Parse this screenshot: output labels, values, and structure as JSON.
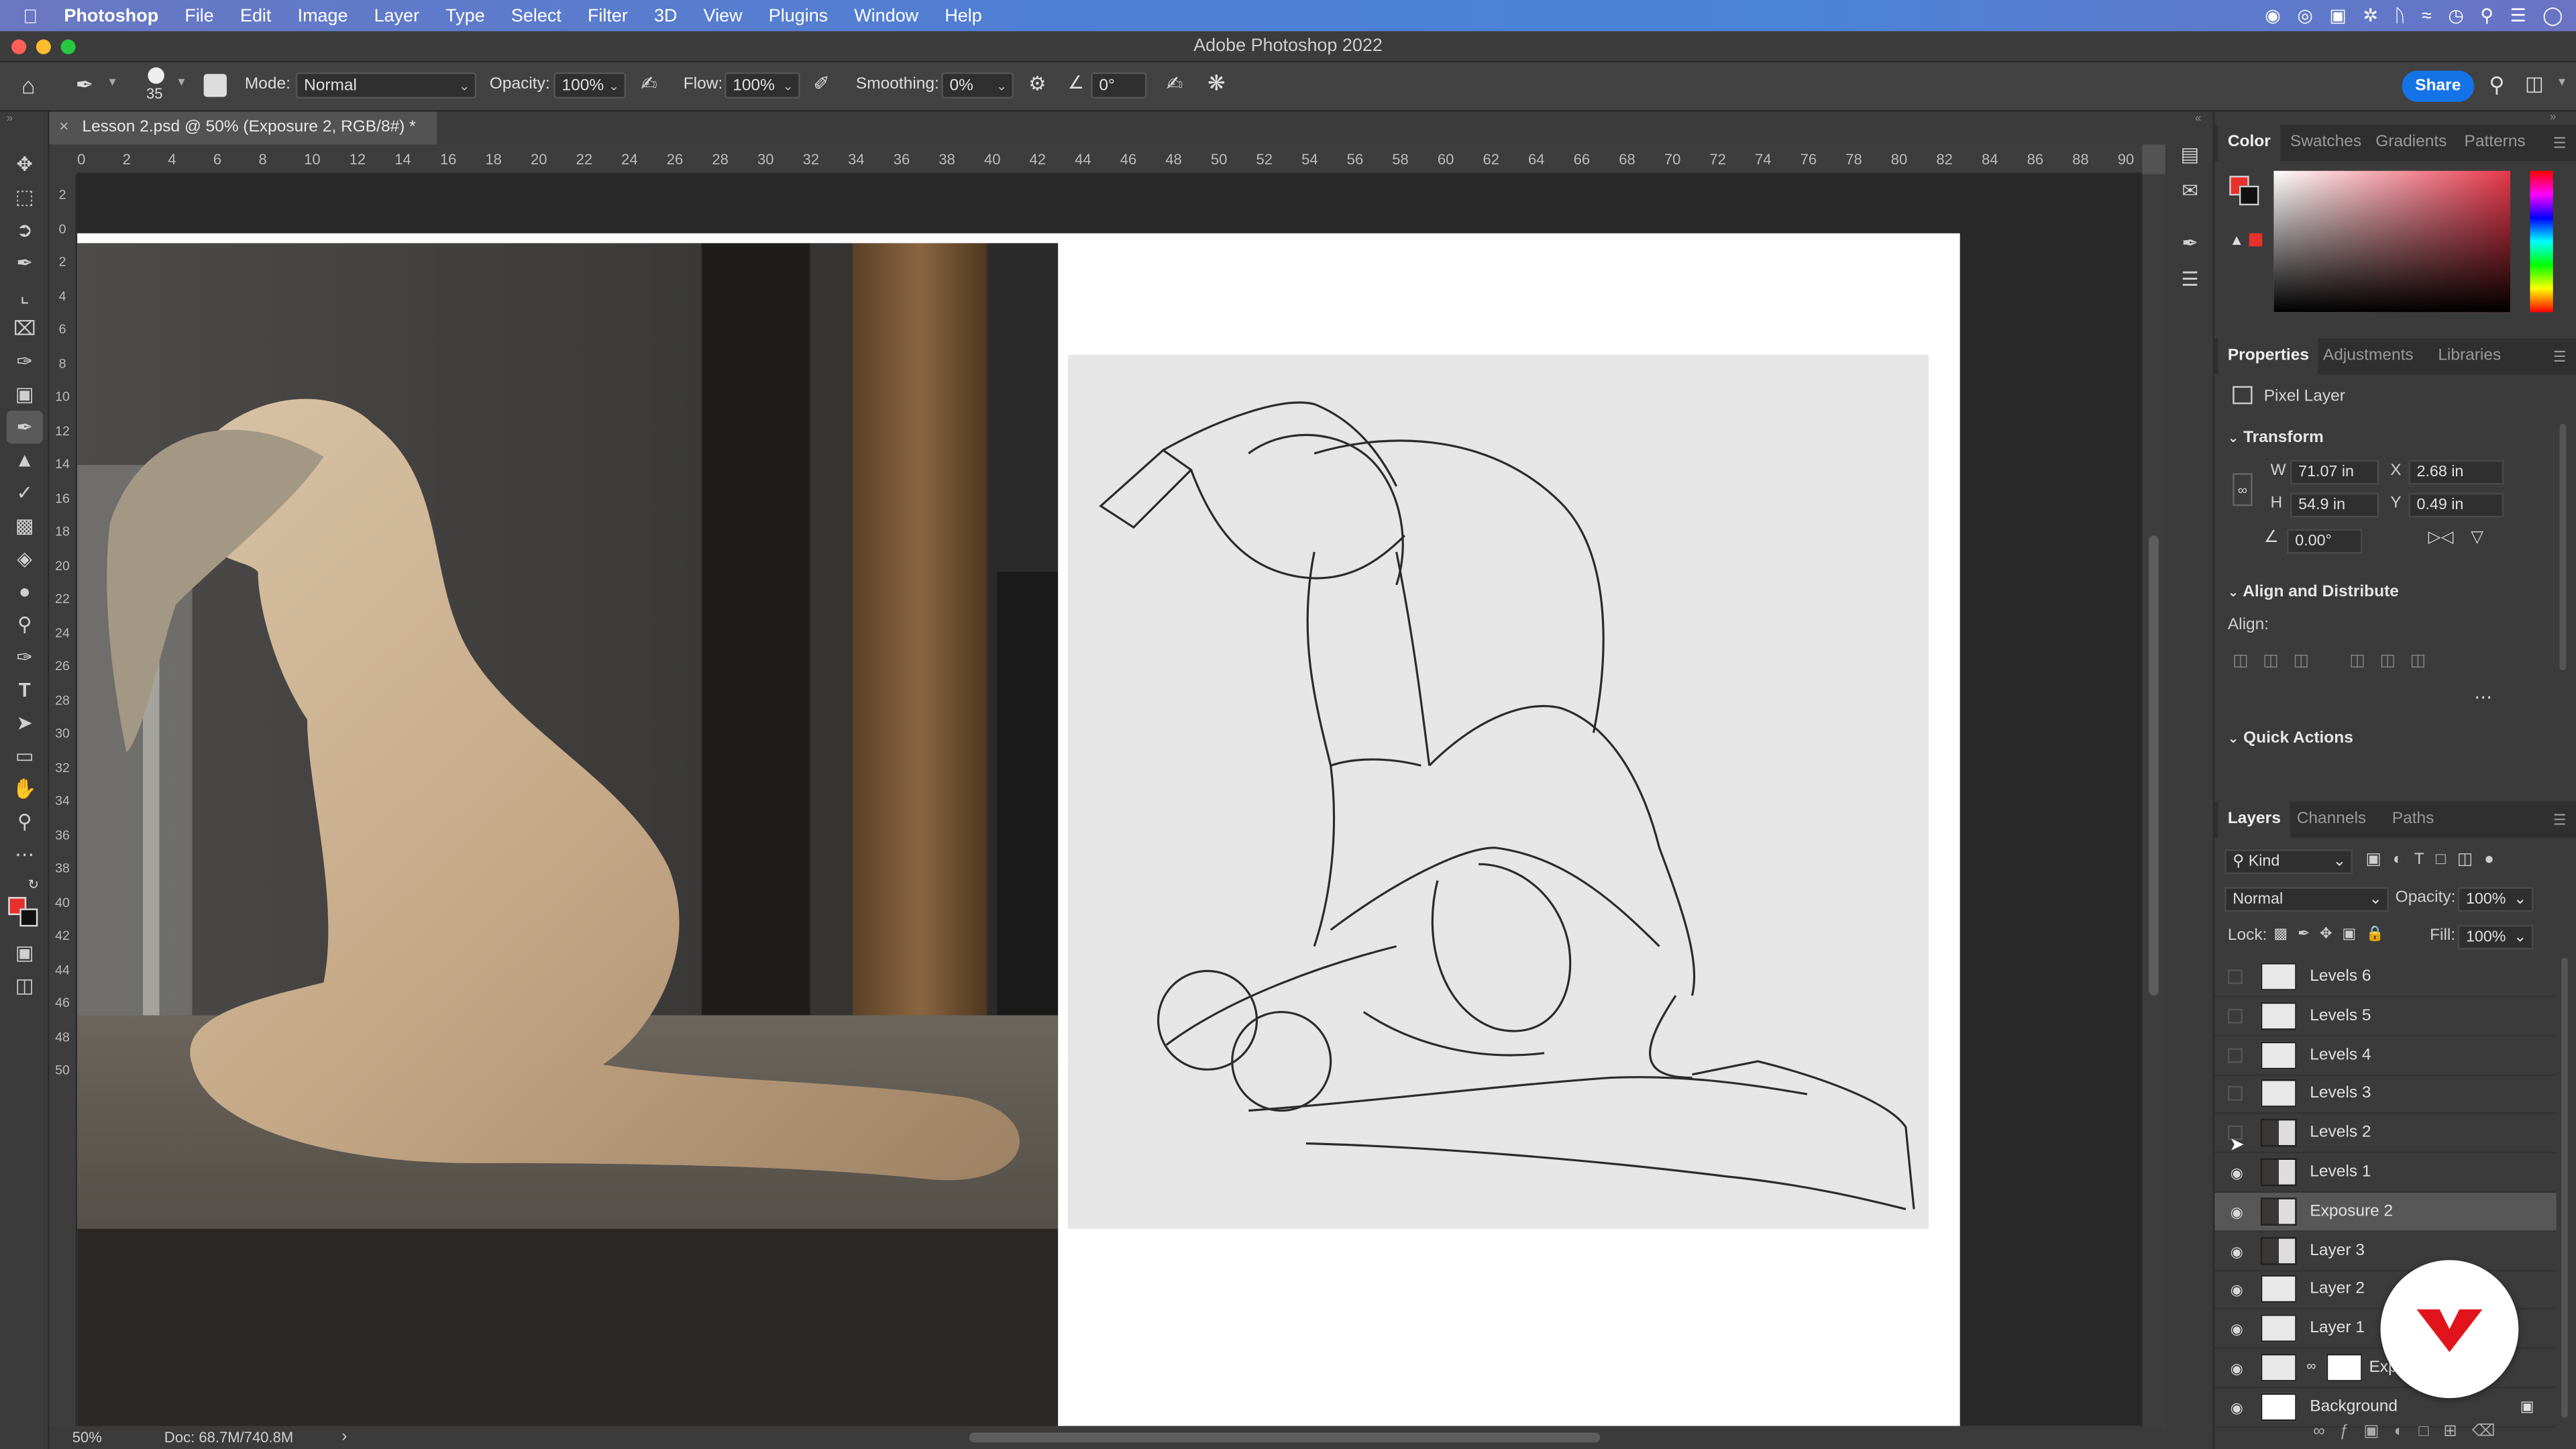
{
  "menubar": {
    "app": "Photoshop",
    "items": [
      "File",
      "Edit",
      "Image",
      "Layer",
      "Type",
      "Select",
      "Filter",
      "3D",
      "View",
      "Plugins",
      "Window",
      "Help"
    ]
  },
  "window": {
    "title": "Adobe Photoshop 2022"
  },
  "options": {
    "brush_size": "35",
    "mode_label": "Mode:",
    "mode_value": "Normal",
    "opacity_label": "Opacity:",
    "opacity_value": "100%",
    "flow_label": "Flow:",
    "flow_value": "100%",
    "smoothing_label": "Smoothing:",
    "smoothing_value": "0%",
    "angle_value": "0°",
    "share_label": "Share"
  },
  "document": {
    "tab_title": "Lesson 2.psd @ 50% (Exposure 2, RGB/8#) *"
  },
  "ruler": {
    "h_ticks": [
      "0",
      "2",
      "4",
      "6",
      "8",
      "10",
      "12",
      "14",
      "16",
      "18",
      "20",
      "22",
      "24",
      "26",
      "28",
      "30",
      "32",
      "34",
      "36",
      "38",
      "40",
      "42",
      "44",
      "46",
      "48",
      "50",
      "52",
      "54",
      "56",
      "58",
      "60",
      "62",
      "64",
      "66",
      "68",
      "70",
      "72",
      "74",
      "76",
      "78",
      "80",
      "82",
      "84",
      "86",
      "88",
      "90"
    ],
    "v_ticks": [
      "2",
      "0",
      "2",
      "4",
      "6",
      "8",
      "10",
      "12",
      "14",
      "16",
      "18",
      "20",
      "22",
      "24",
      "26",
      "28",
      "30",
      "32",
      "34",
      "36",
      "38",
      "40",
      "42",
      "44",
      "46",
      "48",
      "50"
    ]
  },
  "status": {
    "zoom": "50%",
    "doc": "Doc: 68.7M/740.8M"
  },
  "color_panel": {
    "tabs": [
      "Color",
      "Swatches",
      "Gradients",
      "Patterns"
    ],
    "fg": "#e8302c",
    "bg": "#111111"
  },
  "properties": {
    "tabs": [
      "Properties",
      "Adjustments",
      "Libraries"
    ],
    "type_label": "Pixel Layer",
    "transform_header": "Transform",
    "w_label": "W",
    "w_value": "71.07 in",
    "x_label": "X",
    "x_value": "2.68 in",
    "h_label": "H",
    "h_value": "54.9 in",
    "y_label": "Y",
    "y_value": "0.49 in",
    "angle_value": "0.00°",
    "align_header": "Align and Distribute",
    "align_label": "Align:",
    "quick_actions": "Quick Actions"
  },
  "layers_panel": {
    "tabs": [
      "Layers",
      "Channels",
      "Paths"
    ],
    "kind_label": "Kind",
    "blend_mode": "Normal",
    "opacity_label": "Opacity:",
    "opacity_value": "100%",
    "lock_label": "Lock:",
    "fill_label": "Fill:",
    "fill_value": "100%",
    "layers": [
      {
        "name": "Levels 6",
        "visible": false
      },
      {
        "name": "Levels 5",
        "visible": false
      },
      {
        "name": "Levels 4",
        "visible": false
      },
      {
        "name": "Levels 3",
        "visible": false
      },
      {
        "name": "Levels 2",
        "visible": false
      },
      {
        "name": "Levels 1",
        "visible": true
      },
      {
        "name": "Exposure 2",
        "visible": true,
        "selected": true
      },
      {
        "name": "Layer 3",
        "visible": true
      },
      {
        "name": "Layer 2",
        "visible": true
      },
      {
        "name": "Layer 1",
        "visible": true
      },
      {
        "name": "Exp",
        "visible": true
      },
      {
        "name": "Background",
        "visible": true,
        "locked": true
      }
    ]
  }
}
